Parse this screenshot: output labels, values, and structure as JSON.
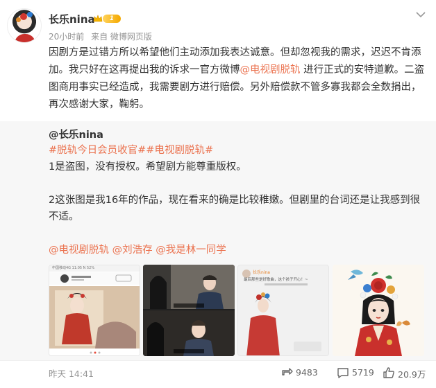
{
  "post": {
    "username": "长乐nina",
    "badge_level": "1",
    "meta": {
      "time": "20小时前",
      "source": "来自 微博网页版"
    },
    "text": {
      "part1": "因剧方是过错方所以希望他们主动添加我表达诚意。但却忽视我的需求，迟迟不肯添加。我只好在这再提出我的诉求一官方微博",
      "mention": "@电视剧脱轨",
      "part2": " 进行正式的安特道歉。二盗图商用事实已经造成，我需要剧方进行赔偿。另外赔偿款不管多寡我都会全数捐出，再次感谢大家，鞠躬。"
    }
  },
  "repost": {
    "author": "@长乐nina",
    "hashtags": "#脱轨今日会员收官##电视剧脱轨#",
    "line1": "1是盗图，没有授权。希望剧方能尊重版权。",
    "line2": "2这张图是我16年的作品，现在看来的确是比较稚嫩。但剧里的台词还是让我感到很不适。",
    "mentions": "@电视剧脱轨 @刘浩存 @我是林一同学",
    "thumb1": {
      "status": "中国移动4G 11:05 N 52%"
    },
    "thumb3": {
      "username": "长乐nina",
      "caption": "最后那些是好歌曲，这个孩子开心！~"
    }
  },
  "footer": {
    "time": "昨天 14:41",
    "reposts": "9483",
    "comments": "5719",
    "likes": "20.9万"
  },
  "colors": {
    "accent": "#eb7350",
    "muted": "#939393",
    "repost_bg": "#f7f7f7"
  }
}
